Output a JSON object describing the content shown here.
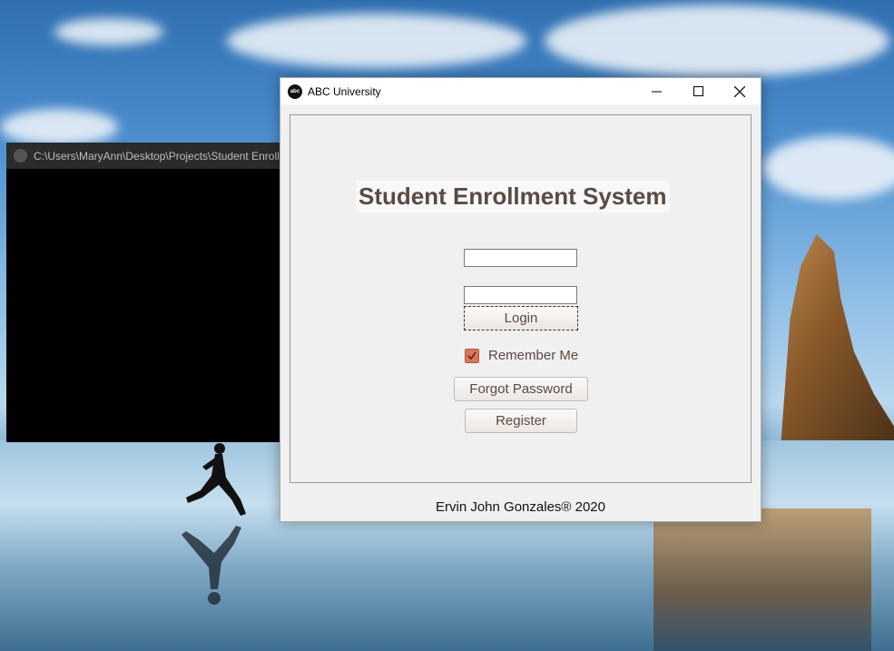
{
  "console": {
    "title": "C:\\Users\\MaryAnn\\Desktop\\Projects\\Student Enrollm"
  },
  "window": {
    "title": "ABC University",
    "icon_text": "abc",
    "controls": [
      "minimize-icon",
      "maximize-icon",
      "close-icon"
    ]
  },
  "form": {
    "heading": "Student Enrollment System",
    "username": {
      "value": "",
      "placeholder": ""
    },
    "password": {
      "value": "",
      "placeholder": ""
    },
    "login_label": "Login",
    "remember_label": "Remember Me",
    "remember_checked": true,
    "forgot_label": "Forgot Password",
    "register_label": "Register"
  },
  "footer": {
    "text": "Ervin John Gonzales® 2020"
  },
  "colors": {
    "accent": "#d9765a",
    "text": "#5a4a42"
  }
}
